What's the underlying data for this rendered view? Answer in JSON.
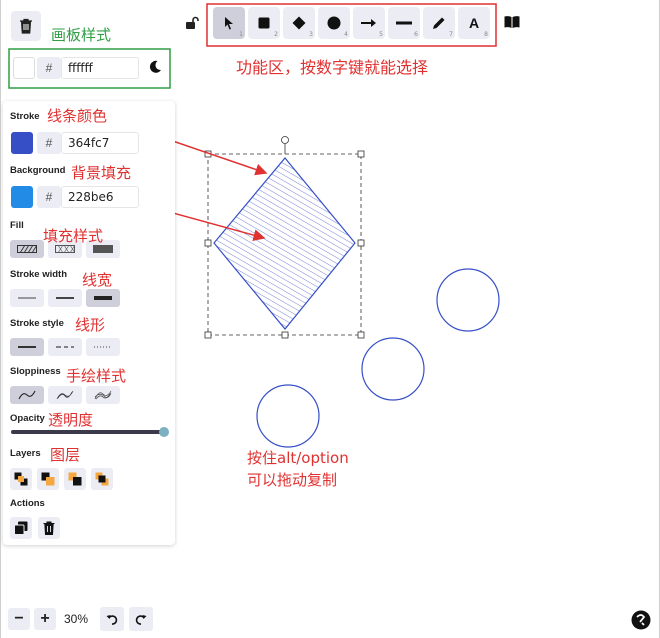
{
  "annotations": {
    "canvas_style": "画板样式",
    "toolbar_area": "功能区，按数字键就能选择",
    "stroke_color": "线条颜色",
    "background_fill": "背景填充",
    "fill_style": "填充样式",
    "stroke_width": "线宽",
    "stroke_style": "线形",
    "sloppiness": "手绘样式",
    "opacity": "透明度",
    "layers": "图层",
    "alt_line1": "按住alt/option",
    "alt_line2": "可以拖动复制"
  },
  "canvas_bg": {
    "hash": "#",
    "value": "ffffff"
  },
  "toolbar": {
    "tools": [
      {
        "name": "selection",
        "icon": "pointer-icon",
        "num": "1",
        "active": true
      },
      {
        "name": "rectangle",
        "icon": "square-icon",
        "num": "2"
      },
      {
        "name": "diamond",
        "icon": "diamond-icon",
        "num": "3"
      },
      {
        "name": "ellipse",
        "icon": "circle-icon",
        "num": "4"
      },
      {
        "name": "arrow",
        "icon": "arrow-icon",
        "num": "5"
      },
      {
        "name": "line",
        "icon": "line-icon",
        "num": "6"
      },
      {
        "name": "draw",
        "icon": "pencil-icon",
        "num": "7"
      },
      {
        "name": "text",
        "icon": "text-icon",
        "num": "8",
        "glyph": "A"
      }
    ]
  },
  "props": {
    "stroke_label": "Stroke",
    "stroke_hash": "#",
    "stroke_value": "364fc7",
    "stroke_color": "#364fc7",
    "background_label": "Background",
    "background_hash": "#",
    "background_value": "228be6",
    "background_color": "#228be6",
    "fill_label": "Fill",
    "stroke_width_label": "Stroke width",
    "stroke_style_label": "Stroke style",
    "sloppiness_label": "Sloppiness",
    "opacity_label": "Opacity",
    "opacity_value": 1.0,
    "layers_label": "Layers",
    "actions_label": "Actions"
  },
  "zoom": {
    "minus": "−",
    "plus": "+",
    "level": "30%"
  },
  "colors": {
    "accent": "#364fc7",
    "annotation_red": "#e03131",
    "annotation_green": "#2f9e44",
    "button_bg": "#ececf4"
  }
}
